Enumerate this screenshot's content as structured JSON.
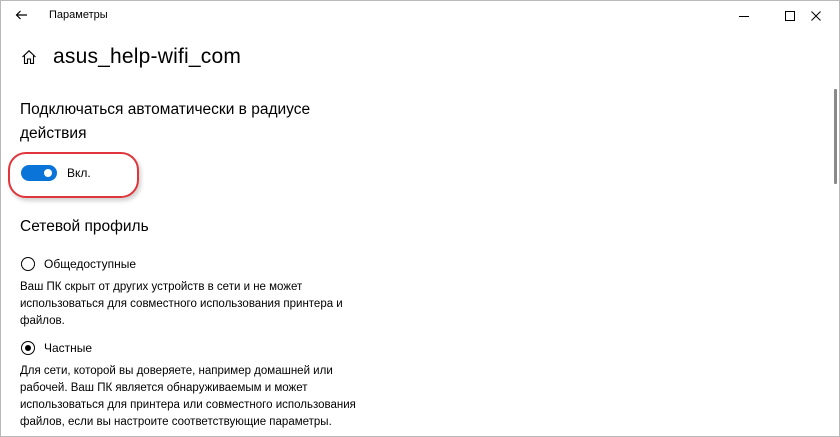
{
  "window": {
    "title": "Параметры",
    "controls": {
      "minimize": "minimize",
      "maximize": "maximize",
      "close": "close"
    }
  },
  "header": {
    "page_title": "asus_help-wifi_com"
  },
  "auto_connect": {
    "title": "Подключаться автоматически в радиусе действия",
    "toggle_state": "Вкл.",
    "enabled": true
  },
  "network_profile": {
    "title": "Сетевой профиль",
    "options": [
      {
        "label": "Общедоступные",
        "selected": false,
        "description": "Ваш ПК скрыт от других устройств в сети и не может использоваться для совместного использования принтера и файлов."
      },
      {
        "label": "Частные",
        "selected": true,
        "description": "Для сети, которой вы доверяете, например домашней или рабочей. Ваш ПК является обнаруживаемым и может использоваться для принтера или совместного использования файлов, если вы настроите соответствующие параметры."
      }
    ]
  },
  "colors": {
    "accent": "#0a74d8",
    "highlight": "#e0353a"
  },
  "icons": {
    "back": "back-arrow-icon",
    "home": "home-icon"
  }
}
